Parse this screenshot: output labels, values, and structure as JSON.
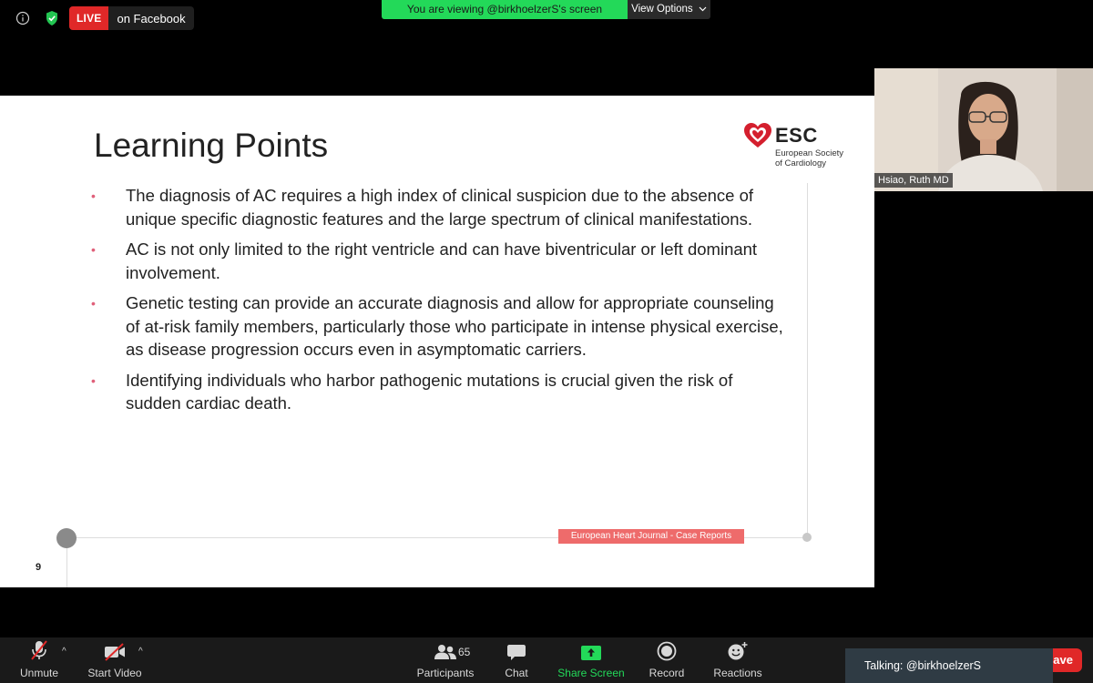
{
  "top_bar": {
    "live_badge": "LIVE",
    "live_destination": "on Facebook",
    "viewing_banner": "You are viewing @birkhoelzerS's screen",
    "view_options": "View Options"
  },
  "slide": {
    "title": "Learning Points",
    "logo_text": "ESC",
    "logo_subtitle_line1": "European Society",
    "logo_subtitle_line2": "of Cardiology",
    "bullets": [
      "The diagnosis of AC requires a high index of clinical suspicion due to the absence of unique specific diagnostic features and the large spectrum of clinical manifestations.",
      "AC is not only limited to the right ventricle and can have biventricular or left dominant involvement.",
      "Genetic testing can provide an accurate diagnosis and allow for appropriate counseling of at-risk family members, particularly those who participate in intense physical exercise, as disease progression occurs even in asymptomatic carriers.",
      "Identifying individuals who harbor pathogenic mutations is crucial given the risk of sudden cardiac death."
    ],
    "journal_tag": "European Heart Journal - Case Reports",
    "page_number": "9"
  },
  "participant_video": {
    "name": "Hsiao, Ruth MD"
  },
  "toolbar": {
    "unmute": "Unmute",
    "start_video": "Start Video",
    "participants": "Participants",
    "participants_count": "65",
    "chat": "Chat",
    "share_screen": "Share Screen",
    "record": "Record",
    "reactions": "Reactions",
    "leave": "ave"
  },
  "talking_indicator": "Talking: @birkhoelzerS",
  "colors": {
    "live_red": "#e02828",
    "share_green": "#23d959",
    "bullet_pink": "#e0607a",
    "journal_tag_bg": "#ee6b6b"
  }
}
